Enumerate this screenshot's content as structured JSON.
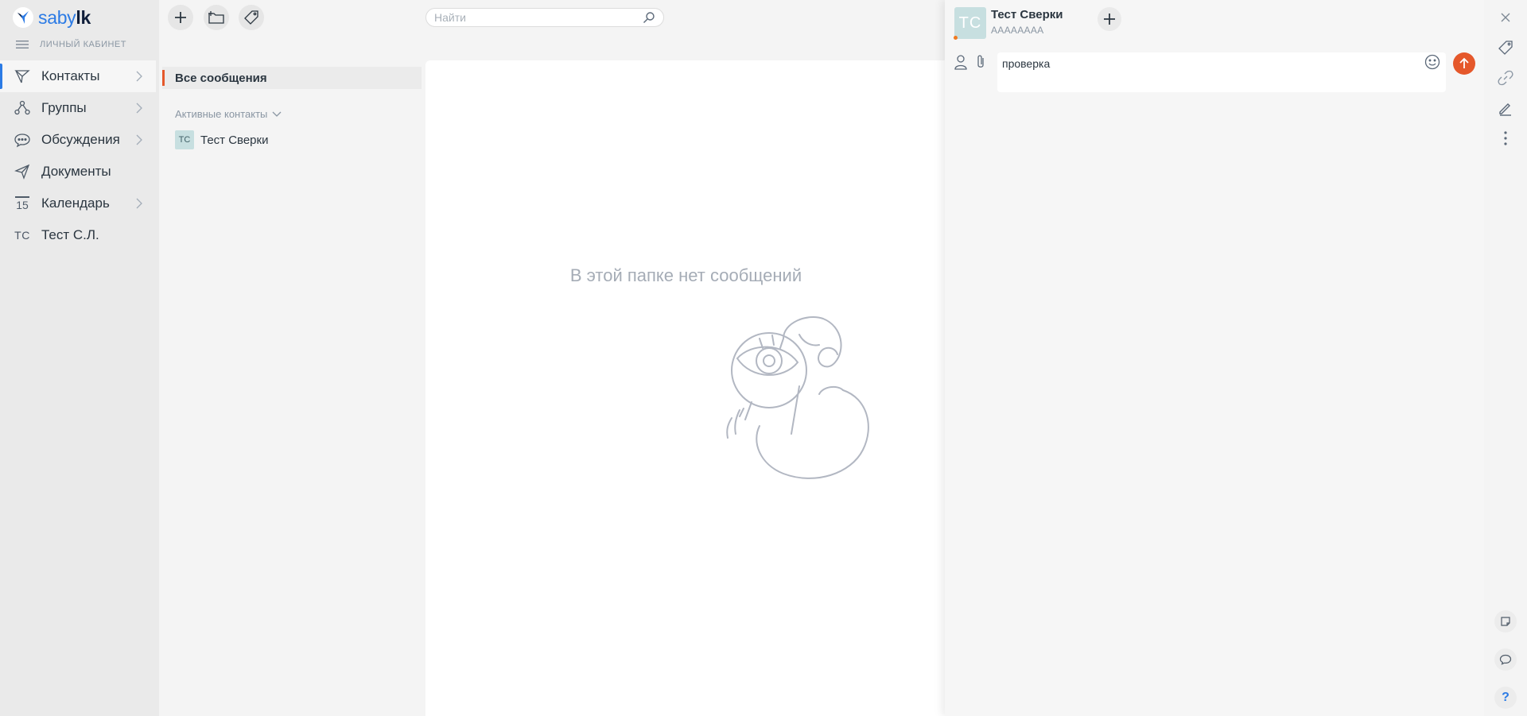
{
  "app": {
    "logo_part1": "saby",
    "logo_part2": "lk",
    "cabinet_label": "ЛИЧНЫЙ КАБИНЕТ"
  },
  "nav": {
    "items": [
      {
        "label": "Контакты",
        "icon": "send-icon",
        "active": true,
        "chevron": true
      },
      {
        "label": "Группы",
        "icon": "groups-icon",
        "active": false,
        "chevron": true
      },
      {
        "label": "Обсуждения",
        "icon": "chat-dots-icon",
        "active": false,
        "chevron": true
      },
      {
        "label": "Документы",
        "icon": "paper-plane-icon",
        "active": false,
        "chevron": false
      },
      {
        "label": "Календарь",
        "icon": "calendar-icon",
        "calendar_day": "15",
        "active": false,
        "chevron": true
      },
      {
        "label": "Тест С.Л.",
        "icon": "user-avatar",
        "avatar_initials": "ТС",
        "active": false,
        "chevron": false
      }
    ]
  },
  "search": {
    "placeholder": "Найти"
  },
  "folders": {
    "all_messages": "Все сообщения",
    "active_contacts": "Активные контакты",
    "contact": {
      "initials": "ТС",
      "name": "Тест Сверки"
    }
  },
  "center": {
    "empty_text": "В этой папке нет сообщений"
  },
  "dialog": {
    "avatar_initials": "ТС",
    "name": "Тест Сверки",
    "subtitle": "АААААААА",
    "message_text": "проверка",
    "accent": "#e5582b",
    "help_label": "?"
  },
  "colors": {
    "brand_blue": "#2c7be5",
    "accent_orange": "#e5582b",
    "avatar_bg": "#c7dfe0"
  }
}
